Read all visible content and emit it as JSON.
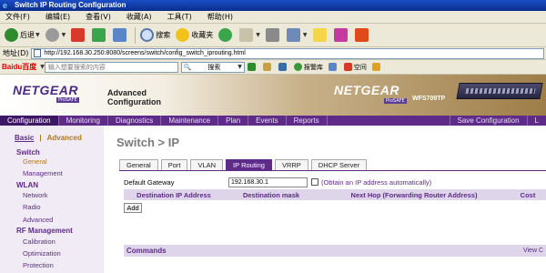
{
  "window": {
    "title": "Switch IP Routing Configuration"
  },
  "menu": [
    "文件(F)",
    "编辑(E)",
    "查看(V)",
    "收藏(A)",
    "工具(T)",
    "帮助(H)"
  ],
  "toolbar": {
    "back_label": "后退",
    "search_label": "搜索",
    "favorites_label": "收藏夹"
  },
  "address": {
    "label": "地址(D)",
    "url": "http://192.168.30.250:8080/screens/switch/config_switch_iprouting.html"
  },
  "baidu_bar": {
    "logo": "Baidu百度",
    "input_placeholder": "输入想要搜索的内容",
    "search_label": "搜索",
    "alarm_label": "报警库",
    "space_label": "空间"
  },
  "header": {
    "logo": "NETGEAR",
    "prosafe": "ProSAFE",
    "advanced_line1": "Advanced",
    "advanced_line2": "Configuration",
    "right_logo": "NETGEAR",
    "right_prosafe": "ProSAFE",
    "model": "WFS709TP"
  },
  "nav": {
    "items": [
      "Configuration",
      "Monitoring",
      "Diagnostics",
      "Maintenance",
      "Plan",
      "Events",
      "Reports"
    ],
    "right": [
      "Save Configuration",
      "L"
    ]
  },
  "sidebar": {
    "basic": "Basic",
    "separator": "|",
    "advanced": "Advanced",
    "switch_group": "Switch",
    "switch_general": "General",
    "switch_management": "Management",
    "wlan_group": "WLAN",
    "wlan_network": "Network",
    "wlan_radio": "Radio",
    "wlan_advanced": "Advanced",
    "rf_group": "RF Management",
    "rf_calibration": "Calibration",
    "rf_optimization": "Optimization",
    "rf_protection": "Protection"
  },
  "content": {
    "title": "Switch > IP",
    "tabs": [
      "General",
      "Port",
      "VLAN",
      "IP Routing",
      "VRRP",
      "DHCP Server"
    ],
    "default_gateway_label": "Default Gateway",
    "default_gateway_value": "192.168.30.1",
    "obtain_label": "(Obtain an IP address automatically)",
    "table_headers": [
      "Destination IP Address",
      "Destination mask",
      "Next Hop (Forwarding Router Address)",
      "Cost"
    ],
    "add_label": "Add",
    "commands_label": "Commands",
    "view_commands": "View C"
  }
}
